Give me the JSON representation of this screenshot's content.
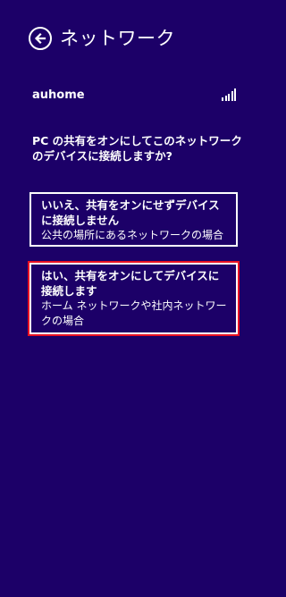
{
  "header": {
    "back_icon": "arrow-left-circle-icon",
    "title": "ネットワーク"
  },
  "network": {
    "name": "auhome",
    "signal_icon": "signal-strength-icon"
  },
  "question": "PC の共有をオンにしてこのネットワークのデバイスに接続しますか?",
  "options": {
    "no": {
      "title": "いいえ、共有をオンにせずデバイスに接続しません",
      "description": "公共の場所にあるネットワークの場合"
    },
    "yes": {
      "title": "はい、共有をオンにしてデバイスに接続します",
      "description": "ホーム ネットワークや社内ネットワークの場合"
    }
  },
  "colors": {
    "background": "#1c0068",
    "text": "#ffffff",
    "focus_outline": "#e81123"
  }
}
